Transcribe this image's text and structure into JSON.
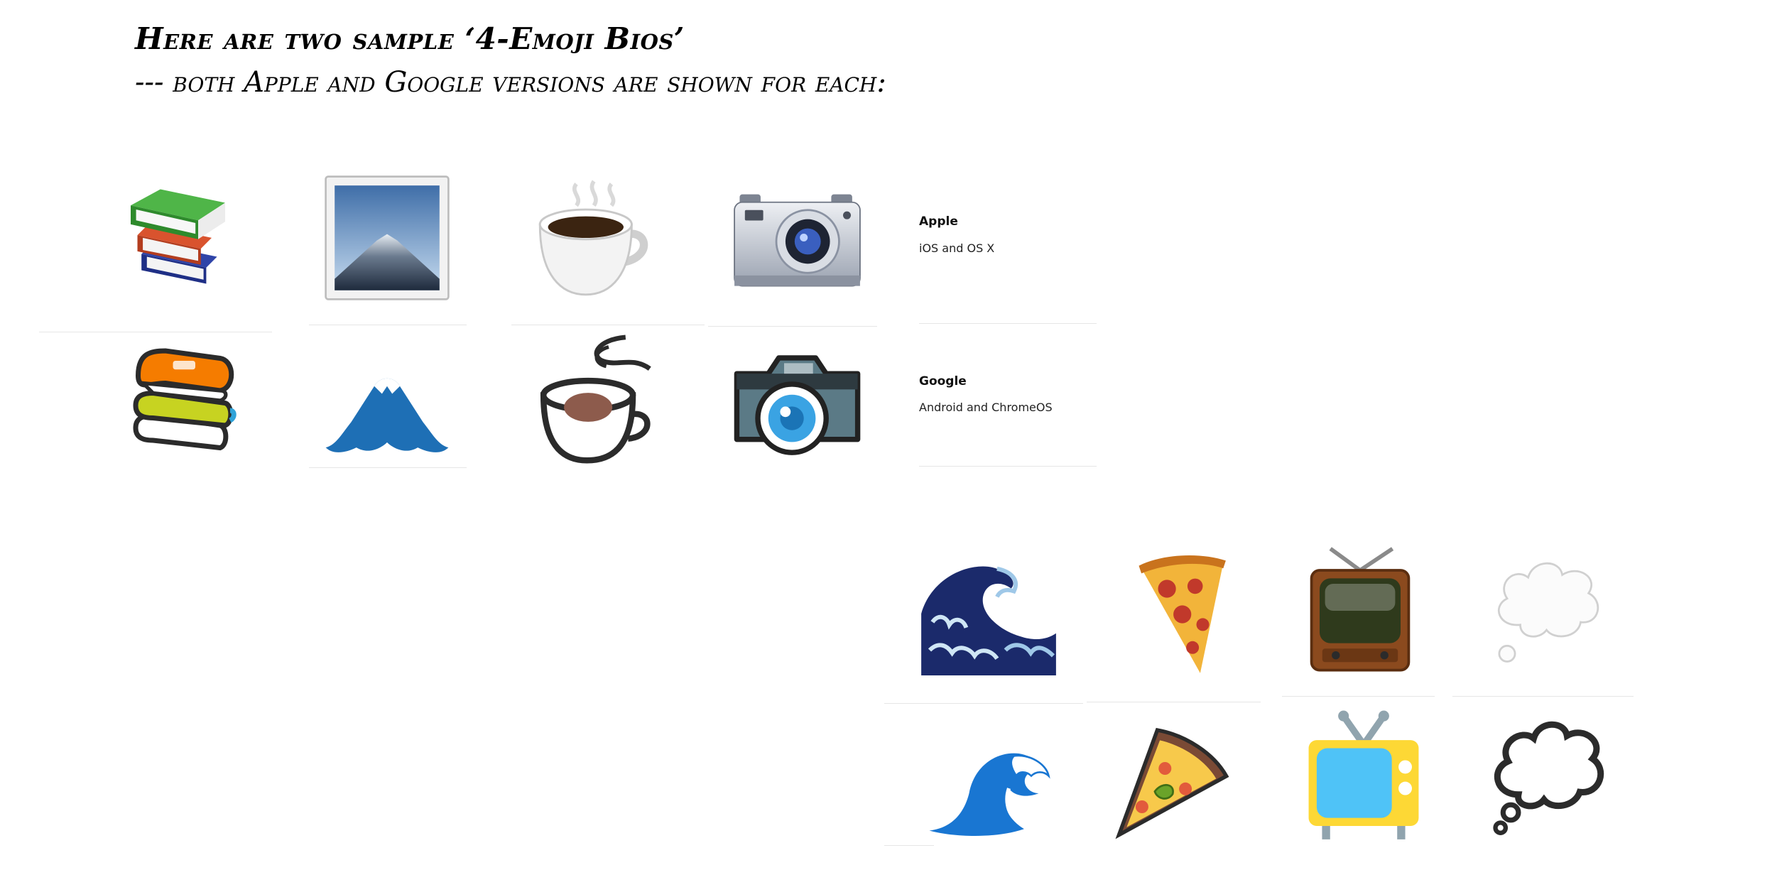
{
  "heading": {
    "line1": "Here are two sample ‘4-Emoji Bios’",
    "line2": "--- both Apple and Google versions are shown for each:"
  },
  "legend": {
    "apple": {
      "vendor": "Apple",
      "platforms": "iOS and OS X"
    },
    "google": {
      "vendor": "Google",
      "platforms": "Android and ChromeOS"
    }
  },
  "bio1": {
    "apple": [
      "books-icon",
      "mount-fuji-icon",
      "hot-beverage-icon",
      "camera-icon"
    ],
    "google": [
      "books-icon",
      "mount-fuji-icon",
      "hot-beverage-icon",
      "camera-icon"
    ]
  },
  "bio2": {
    "apple": [
      "water-wave-icon",
      "pizza-icon",
      "television-icon",
      "thought-balloon-icon"
    ],
    "google": [
      "water-wave-icon",
      "pizza-icon",
      "television-icon",
      "thought-balloon-icon"
    ]
  }
}
